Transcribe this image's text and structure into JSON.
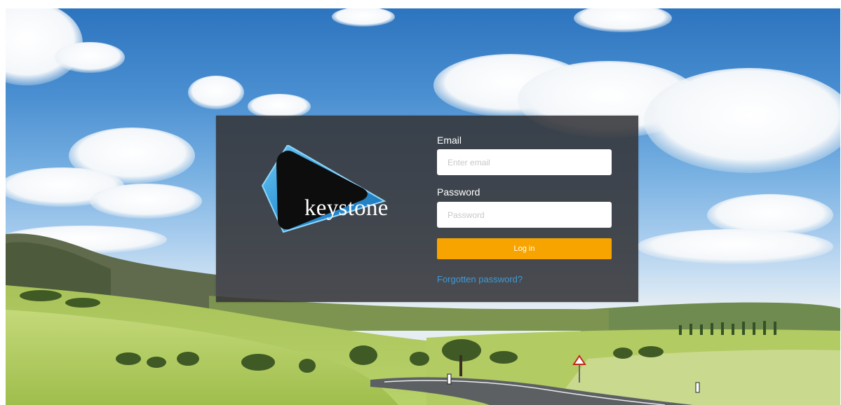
{
  "brand": {
    "name": "keystone",
    "logo_icon": "play-triangle-icon",
    "colors": {
      "accent_blue": "#3aa8e6",
      "logo_black": "#0d0d0d"
    }
  },
  "login_form": {
    "email_label": "Email",
    "email_placeholder": "Enter email",
    "email_value": "",
    "password_label": "Password",
    "password_placeholder": "Password",
    "password_value": "",
    "submit_label": "Log in",
    "forgot_label": "Forgotten password?"
  },
  "colors": {
    "panel_bg": "#343438",
    "button_bg": "#f7a400",
    "link": "#3f9ad9"
  }
}
